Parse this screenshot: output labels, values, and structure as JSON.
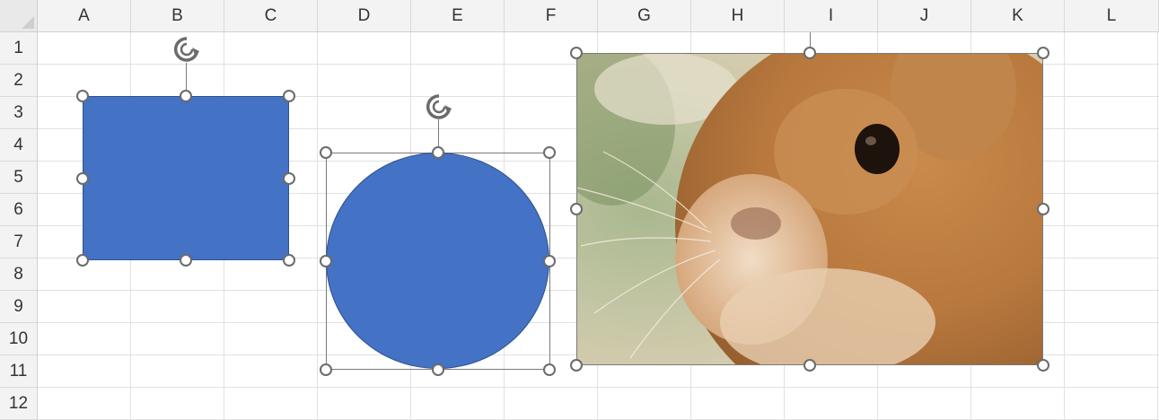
{
  "sheet": {
    "columns": [
      "A",
      "B",
      "C",
      "D",
      "E",
      "F",
      "G",
      "H",
      "I",
      "J",
      "K",
      "L"
    ],
    "rows": [
      "1",
      "2",
      "3",
      "4",
      "5",
      "6",
      "7",
      "8",
      "9",
      "10",
      "11",
      "12"
    ]
  },
  "shapes": {
    "rectangle": {
      "fill": "#4472c4",
      "outline": "#2f528f"
    },
    "oval": {
      "fill": "#4472c4",
      "outline": "#2f528f"
    },
    "picture": {
      "subject": "rabbit-photo"
    }
  },
  "icons": {
    "rotate": "rotate-icon",
    "handle": "resize-handle"
  },
  "colors": {
    "selection": "#6b6b6b",
    "header_bg": "#f3f3f3",
    "grid": "#e1e1e1"
  }
}
